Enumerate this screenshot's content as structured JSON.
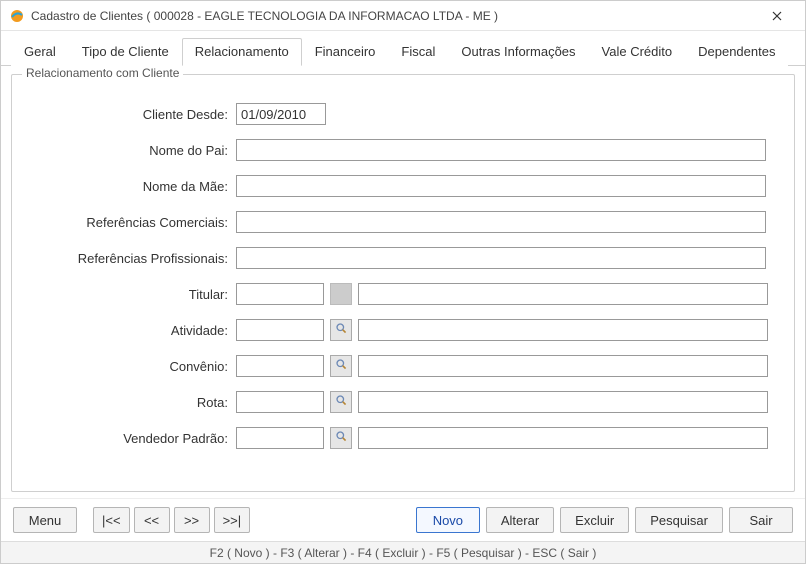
{
  "window": {
    "title": "Cadastro de Clientes ( 000028 - EAGLE TECNOLOGIA DA INFORMACAO LTDA - ME )"
  },
  "tabs": [
    {
      "label": "Geral"
    },
    {
      "label": "Tipo de Cliente"
    },
    {
      "label": "Relacionamento"
    },
    {
      "label": "Financeiro"
    },
    {
      "label": "Fiscal"
    },
    {
      "label": "Outras Informações"
    },
    {
      "label": "Vale Crédito"
    },
    {
      "label": "Dependentes"
    }
  ],
  "active_tab_index": 2,
  "groupbox_title": "Relacionamento com Cliente",
  "fields": {
    "cliente_desde": {
      "label": "Cliente Desde:",
      "value": "01/09/2010"
    },
    "nome_pai": {
      "label": "Nome do Pai:",
      "value": ""
    },
    "nome_mae": {
      "label": "Nome da Mãe:",
      "value": ""
    },
    "ref_comerciais": {
      "label": "Referências Comerciais:",
      "value": ""
    },
    "ref_profissionais": {
      "label": "Referências Profissionais:",
      "value": ""
    },
    "titular": {
      "label": "Titular:",
      "code": "",
      "desc": ""
    },
    "atividade": {
      "label": "Atividade:",
      "code": "",
      "desc": ""
    },
    "convenio": {
      "label": "Convênio:",
      "code": "",
      "desc": ""
    },
    "rota": {
      "label": "Rota:",
      "code": "",
      "desc": ""
    },
    "vendedor_padrao": {
      "label": "Vendedor Padrão:",
      "code": "",
      "desc": ""
    }
  },
  "bottom_buttons": {
    "menu": "Menu",
    "nav_first": "|<<",
    "nav_prev": "<<",
    "nav_next": ">>",
    "nav_last": ">>|",
    "novo": "Novo",
    "alterar": "Alterar",
    "excluir": "Excluir",
    "pesquisar": "Pesquisar",
    "sair": "Sair"
  },
  "statusbar": "F2 ( Novo )  -  F3 ( Alterar )  -  F4 ( Excluir )  -  F5 ( Pesquisar )  -  ESC ( Sair )"
}
